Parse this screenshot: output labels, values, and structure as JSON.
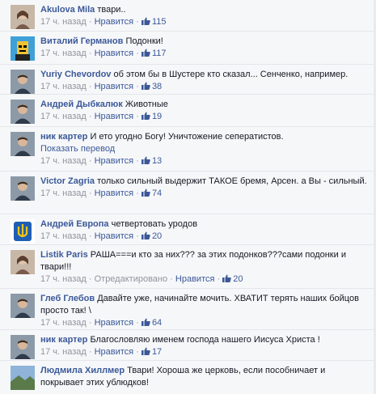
{
  "labels": {
    "like": "Нравится",
    "edited": "Отредактировано",
    "translate": "Показать перевод",
    "separator": "·"
  },
  "comments": [
    {
      "author": "Akulova Mila",
      "text": "твари..",
      "time": "17 ч. назад",
      "likes": "115",
      "avatar": "woman-photo"
    },
    {
      "author": "Виталий Германов",
      "text": "Подонки!",
      "time": "17 ч. назад",
      "likes": "117",
      "avatar": "cartoon-avatar"
    },
    {
      "author": "Yuriy Chevordov",
      "text": "об этом бы в Шустере кто сказал... Сенченко, например.",
      "time": "17 ч. назад",
      "likes": "38",
      "avatar": "man-photo"
    },
    {
      "author": "Андрей Дыбкалюк",
      "text": "Животные",
      "time": "17 ч. назад",
      "likes": "19",
      "avatar": "man-photo"
    },
    {
      "author": "ник картер",
      "text": "И ето угодно Богу! Уничтожение сеператистов.",
      "time": "17 ч. назад",
      "likes": "13",
      "avatar": "man-photo",
      "translate": true
    },
    {
      "author": "Victor Zagria",
      "text": "только сильный выдержит ТАКОЕ бремя, Арсен. а Вы - сильный.",
      "time": "17 ч. назад",
      "likes": "74",
      "avatar": "man-photo"
    },
    {
      "author": "Андрей Европа",
      "text": "четвертовать уродов",
      "time": "17 ч. назад",
      "likes": "20",
      "avatar": "trident-emblem"
    },
    {
      "author": "Listik Paris",
      "text": "РАША===и кто за них??? за этих подонков???сами подонки и твари!!!",
      "time": "17 ч. назад",
      "likes": "20",
      "avatar": "woman-photo",
      "edited": true
    },
    {
      "author": "Глеб Глебов",
      "text": "Давайте уже, начинайте мочить. ХВАТИТ терять наших бойцов просто так! \\",
      "time": "17 ч. назад",
      "likes": "64",
      "avatar": "man-photo"
    },
    {
      "author": "ник картер",
      "text": "Благословляю именем господа нашего Иисуса Христа !",
      "time": "17 ч. назад",
      "likes": "17",
      "avatar": "man-photo"
    },
    {
      "author": "Людмила Хиллмер",
      "text": "Твари! Хороша же церковь, если пособничает и покрывает этих ублюдков!",
      "time": "",
      "likes": "",
      "avatar": "landscape-photo"
    }
  ]
}
